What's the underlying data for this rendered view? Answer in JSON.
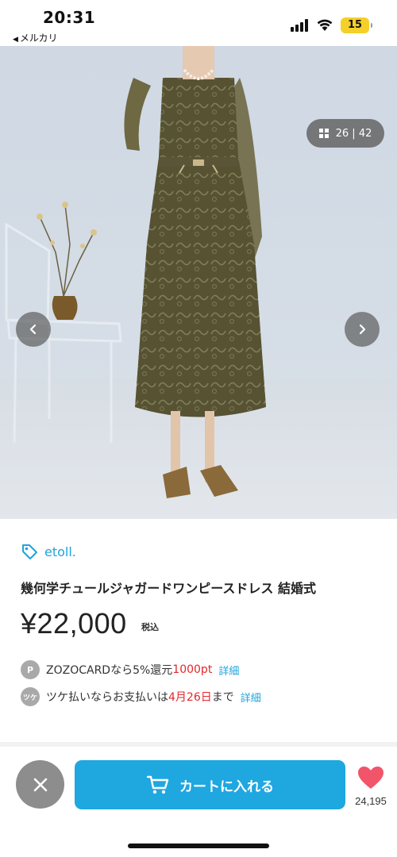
{
  "status_bar": {
    "time": "20:31",
    "back_app": "メルカリ",
    "battery": "15",
    "battery_color": "#f5d02a"
  },
  "gallery": {
    "current": "26",
    "total": "42",
    "separator": "|",
    "prev_icon": "chevron-left-icon",
    "next_icon": "chevron-right-icon"
  },
  "product": {
    "shop_name": "etoll.",
    "title": "幾何学チュールジャガードワンピースドレス 結婚式",
    "price": "¥22,000",
    "tax_label": "税込"
  },
  "promotions": [
    {
      "badge": "P",
      "text": "ZOZOCARDなら5%還元",
      "highlight": "1000pt",
      "link": "詳細"
    },
    {
      "badge": "ツケ",
      "text_before": "ツケ払いならお支払いは",
      "highlight": "4月26日",
      "text_after": "まで",
      "link": "詳細"
    }
  ],
  "bottom_bar": {
    "cart_label": "カートに入れる",
    "like_count": "24,195"
  },
  "colors": {
    "accent": "#1fa7e0",
    "highlight_red": "#e3272c",
    "like_heart": "#f25469",
    "close_button": "#8d8d8d"
  }
}
